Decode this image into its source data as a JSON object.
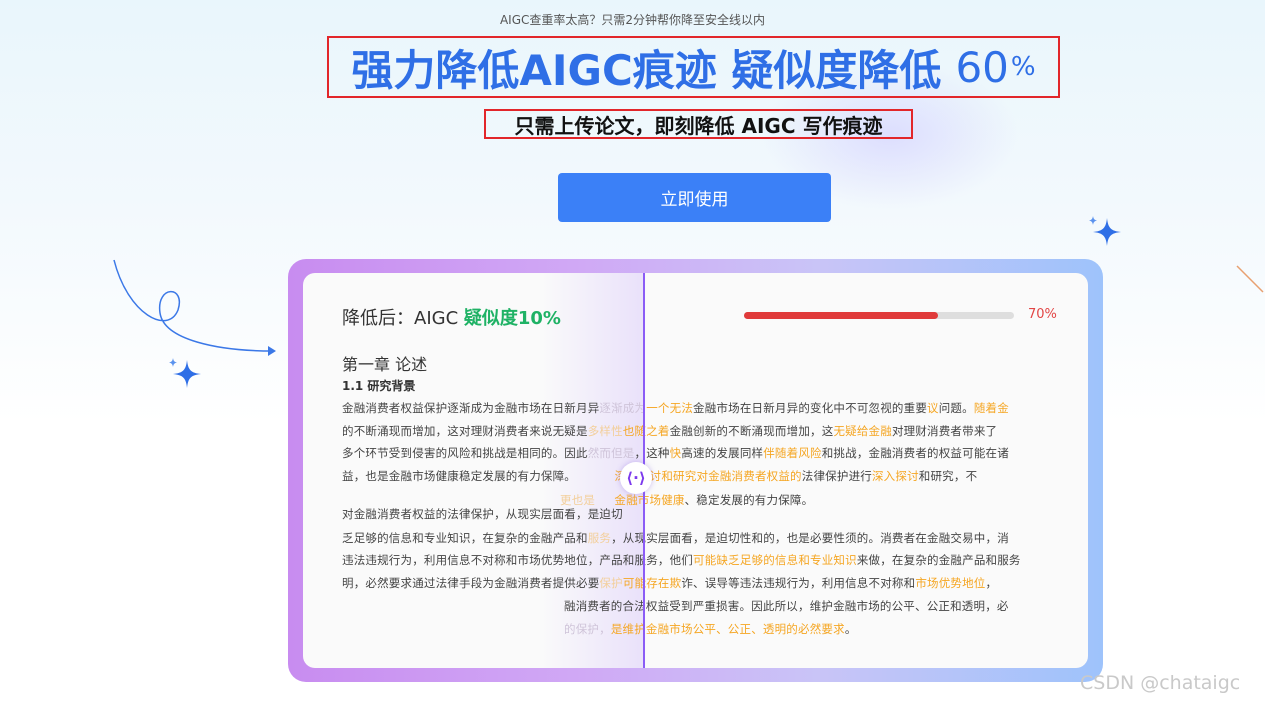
{
  "header": {
    "topline": "AIGC查重率太高？只需2分钟帮你降至安全线以内",
    "title_main": "强力降低AIGC痕迹 疑似度降低",
    "title_pct_num": "60",
    "title_pct_sign": "%",
    "subtitle": "只需上传论文，即刻降低 AIGC 写作痕迹",
    "cta_label": "立即使用"
  },
  "compare": {
    "after_prefix": "降低后：AIGC",
    "after_value": "疑似度10%",
    "progress_text": "70%",
    "progress_fraction": 0.72,
    "chapter": "第一章 论述",
    "section": "1.1 研究背景",
    "handle_glyph": "⟨·⟩",
    "p1": {
      "l1a": "金融消费者权益保护逐渐成为金融市场在日新月异",
      "l1b": "逐渐成为",
      "l1c": "一个无法",
      "l1d": "金融市场在日新月异的变化中不可忽视的重要",
      "l1e": "议",
      "l1f": "问题。",
      "l1g": "随着金",
      "l2a": "的不断涌现而增加，这对理财消费者来说无疑是",
      "l2b": "多样性",
      "l2c": "也随之着",
      "l2d": "金融创新的不断涌现而增加，这",
      "l2e": "无疑给金融",
      "l2f": "对理财消费者带来了",
      "l3a": "多个环节受到侵害的风险和挑战是相同的。因此",
      "l3b": "然而但是",
      "l3c": "，这种",
      "l3d": "快",
      "l3e": "高速的发展同样",
      "l3f": "伴随着风险",
      "l3g": "和挑战，金融消费者的权益可能在诸",
      "l4a": "益，也是金融市场健康稳定发展的有力保障。",
      "l4b": "深入探讨和研究对金融消费者权益的",
      "l4c": "法律保护进行",
      "l4d": "深入探讨",
      "l4e": "和研究，不"
    },
    "p_right_line1a": "更也是",
    "p_right_line1b": "金融市场健康",
    "p_right_line1c": "、稳定发展的有力保障。",
    "p2": {
      "l1": "对金融消费者权益的法律保护，从现实层面看，是迫切",
      "l2a": "乏足够的信息和专业知识，在复杂的金融产品和",
      "l2b": "服务",
      "l2c": "，从现实层面看，是迫切性和的，也是必要性须的。消费者在金融交易中，消",
      "l3a": "违法违规行为，利用信息不对称和市场优势地位，",
      "l3b": "产品和服务，他们",
      "l3c": "可能缺乏足够的信息和专业知识",
      "l3d": "来做，在复杂的金融产品和服务",
      "l4a": "明，必然要求通过法律手段为金融消费者提供必要",
      "l4b": "保护",
      "l4c": "可能存在欺",
      "l4d": "诈、误导等违法违规行为，利用信息不对称和",
      "l4e": "市场优势地位",
      "l4f": "，",
      "l5": "融消费者的合法权益受到严重损害。因此所以，维护金融市场的公平、公正和透明，必",
      "l6a": "的保护，",
      "l6b": "是维护金融市场公平、公正、透明的必然要求",
      "l6c": "。"
    }
  },
  "watermark": "CSDN @chataigc",
  "colors": {
    "accent": "#3b80f7",
    "title_blue": "#2f6fe6",
    "highlight_orange": "#f5a623",
    "after_green": "#1fb265",
    "progress_red": "#e03a3a",
    "annotation_red": "#e2262a"
  }
}
